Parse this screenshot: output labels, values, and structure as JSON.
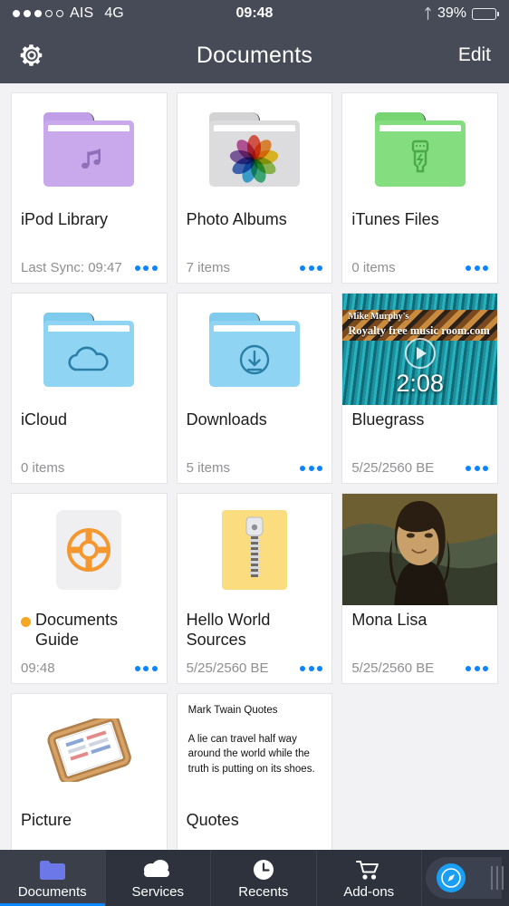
{
  "status_bar": {
    "signal_filled": 3,
    "signal_total": 5,
    "carrier": "AIS",
    "network": "4G",
    "time": "09:48",
    "bluetooth_icon": "bluetooth-icon",
    "battery_percent": "39%",
    "battery_level": 39
  },
  "nav": {
    "settings_icon": "gear-icon",
    "title": "Documents",
    "edit_label": "Edit"
  },
  "colors": {
    "header_bg": "#474b57",
    "page_bg": "#f2f2f4",
    "accent_blue": "#0a84ff",
    "badge_orange": "#f5a623",
    "tabbar_bg": "#2e323c"
  },
  "files": [
    {
      "name": "iPod Library",
      "meta": "Last Sync: 09:47",
      "kind": "folder",
      "icon": "music-folder-icon",
      "folder_color": "#c9a9ec",
      "folder_tab_color": "#c09fe8",
      "has_menu": true,
      "unread": false
    },
    {
      "name": "Photo Albums",
      "meta": "7 items",
      "kind": "folder",
      "icon": "photos-folder-icon",
      "folder_color": "#dcdcde",
      "folder_tab_color": "#d2d2d4",
      "has_menu": true,
      "unread": false
    },
    {
      "name": "iTunes Files",
      "meta": "0 items",
      "kind": "folder",
      "icon": "usb-folder-icon",
      "folder_color": "#84dd7f",
      "folder_tab_color": "#77d571",
      "has_menu": true,
      "unread": false
    },
    {
      "name": "iCloud",
      "meta": "0 items",
      "kind": "folder",
      "icon": "cloud-folder-icon",
      "folder_color": "#8fd4f2",
      "folder_tab_color": "#7fcbee",
      "has_menu": false,
      "unread": false
    },
    {
      "name": "Downloads",
      "meta": "5 items",
      "kind": "folder",
      "icon": "download-folder-icon",
      "folder_color": "#8fd4f2",
      "folder_tab_color": "#7fcbee",
      "has_menu": true,
      "unread": false
    },
    {
      "name": "Bluegrass",
      "meta": "5/25/2560 BE",
      "kind": "video",
      "icon": "video-thumbnail",
      "duration": "2:08",
      "banner_line1": "Mike Murphy's",
      "banner_line2": "Royalty free music room.com",
      "has_menu": true,
      "unread": false
    },
    {
      "name": "Documents Guide",
      "meta": "09:48",
      "kind": "guide",
      "icon": "lifering-icon",
      "has_menu": true,
      "unread": true
    },
    {
      "name": "Hello World Sources",
      "meta": "5/25/2560 BE",
      "kind": "archive",
      "icon": "zip-archive-icon",
      "has_menu": true,
      "unread": false
    },
    {
      "name": "Mona Lisa",
      "meta": "5/25/2560 BE",
      "kind": "image",
      "icon": "image-thumbnail",
      "has_menu": true,
      "unread": false
    },
    {
      "name": "Picture",
      "meta": "",
      "kind": "tray",
      "icon": "paper-tray-icon",
      "has_menu": false,
      "unread": false
    },
    {
      "name": "Quotes",
      "meta": "",
      "kind": "document",
      "icon": "document-preview",
      "preview_title": "Mark Twain Quotes",
      "preview_body": "A lie can travel half way around the world while the truth is putting on its shoes.",
      "has_menu": false,
      "unread": false
    }
  ],
  "tabbar": {
    "items": [
      {
        "label": "Documents",
        "icon": "folder-icon",
        "active": true
      },
      {
        "label": "Services",
        "icon": "cloud-icon",
        "active": false
      },
      {
        "label": "Recents",
        "icon": "clock-icon",
        "active": false
      },
      {
        "label": "Add-ons",
        "icon": "shopping-cart-icon",
        "active": false
      }
    ],
    "browser_button": {
      "icon": "safari-compass-icon",
      "grip_icon": "drag-grip-icon"
    }
  }
}
